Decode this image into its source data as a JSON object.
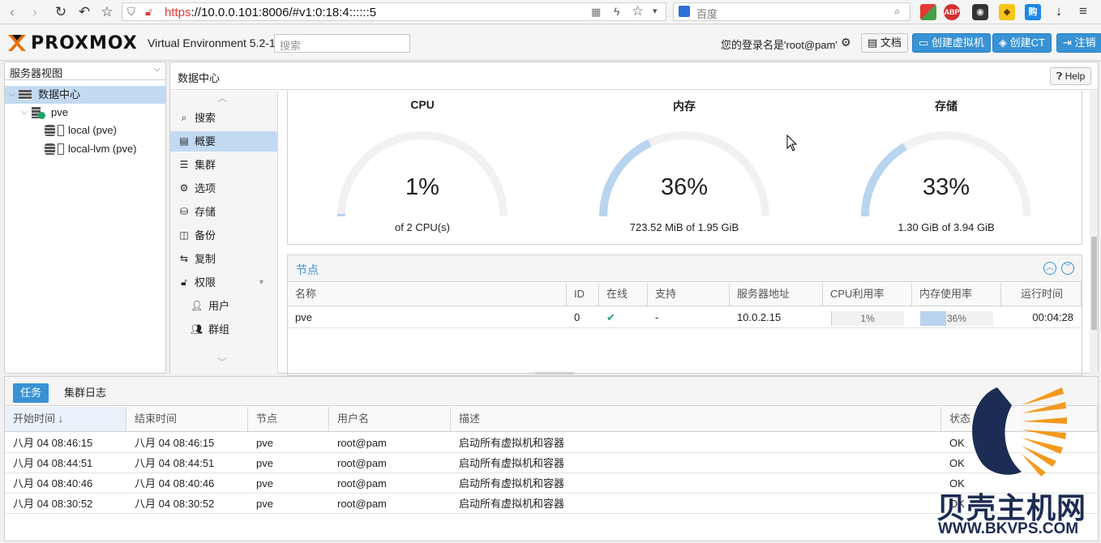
{
  "browser": {
    "url_scheme": "https",
    "url_rest": "://10.0.0.101:8006/#v1:0:18:4::::::5",
    "search_placeholder": "百度",
    "ext_abp": "ABP"
  },
  "header": {
    "logo_text": "PROXMOX",
    "product": "Virtual Environment 5.2-1",
    "search_placeholder": "搜索",
    "login_label": "您的登录名是'root@pam'",
    "docs_button": "文档",
    "create_vm_button": "创建虚拟机",
    "create_ct_button": "创建CT",
    "logout_button": "注销"
  },
  "tree": {
    "view_label": "服务器视图",
    "items": [
      {
        "label": "数据中心"
      },
      {
        "label": "pve"
      },
      {
        "label": "local (pve)"
      },
      {
        "label": "local-lvm (pve)"
      }
    ]
  },
  "content": {
    "title": "数据中心",
    "help_button": "Help"
  },
  "nav": {
    "items": [
      {
        "label": "搜索",
        "icon": "search-icon"
      },
      {
        "label": "概要",
        "icon": "book-icon"
      },
      {
        "label": "集群",
        "icon": "server-icon"
      },
      {
        "label": "选项",
        "icon": "gear-icon"
      },
      {
        "label": "存储",
        "icon": "database-icon"
      },
      {
        "label": "备份",
        "icon": "floppy-icon"
      },
      {
        "label": "复制",
        "icon": "retweet-icon"
      },
      {
        "label": "权限",
        "icon": "unlock-icon"
      },
      {
        "label": "用户",
        "icon": "user-icon"
      },
      {
        "label": "群组",
        "icon": "users-icon"
      }
    ]
  },
  "gauges": [
    {
      "title": "CPU",
      "value": "1%",
      "fraction": 0.01,
      "sub": "of 2 CPU(s)"
    },
    {
      "title": "内存",
      "value": "36%",
      "fraction": 0.36,
      "sub": "723.52 MiB of 1.95 GiB"
    },
    {
      "title": "存储",
      "value": "33%",
      "fraction": 0.33,
      "sub": "1.30 GiB of 3.94 GiB"
    }
  ],
  "nodes": {
    "title": "节点",
    "columns": [
      "名称",
      "ID",
      "在线",
      "支持",
      "服务器地址",
      "CPU利用率",
      "内存使用率",
      "运行时间"
    ],
    "rows": [
      {
        "name": "pve",
        "id": "0",
        "online": "✔",
        "support": "-",
        "address": "10.0.2.15",
        "cpu": "1%",
        "cpu_fraction": 0.01,
        "mem": "36%",
        "mem_fraction": 0.36,
        "uptime": "00:04:28"
      }
    ]
  },
  "tasks": {
    "tabs": [
      "任务",
      "集群日志"
    ],
    "columns": [
      "开始时间 ↓",
      "结束时间",
      "节点",
      "用户名",
      "描述",
      "状态"
    ],
    "rows": [
      {
        "start": "八月 04 08:46:15",
        "end": "八月 04 08:46:15",
        "node": "pve",
        "user": "root@pam",
        "desc": "启动所有虚拟机和容器",
        "status": "OK"
      },
      {
        "start": "八月 04 08:44:51",
        "end": "八月 04 08:44:51",
        "node": "pve",
        "user": "root@pam",
        "desc": "启动所有虚拟机和容器",
        "status": "OK"
      },
      {
        "start": "八月 04 08:40:46",
        "end": "八月 04 08:40:46",
        "node": "pve",
        "user": "root@pam",
        "desc": "启动所有虚拟机和容器",
        "status": "OK"
      },
      {
        "start": "八月 04 08:30:52",
        "end": "八月 04 08:30:52",
        "node": "pve",
        "user": "root@pam",
        "desc": "启动所有虚拟机和容器",
        "status": "OK"
      }
    ]
  },
  "watermark": {
    "text": "贝壳主机网",
    "url": "WWW.BKVPS.COM"
  },
  "colors": {
    "accent": "#3892d4",
    "selected": "#c3daf3",
    "gauge_fill": "#b9d4ef",
    "gauge_track": "#f1f1f1",
    "ok_green": "#21a366"
  }
}
